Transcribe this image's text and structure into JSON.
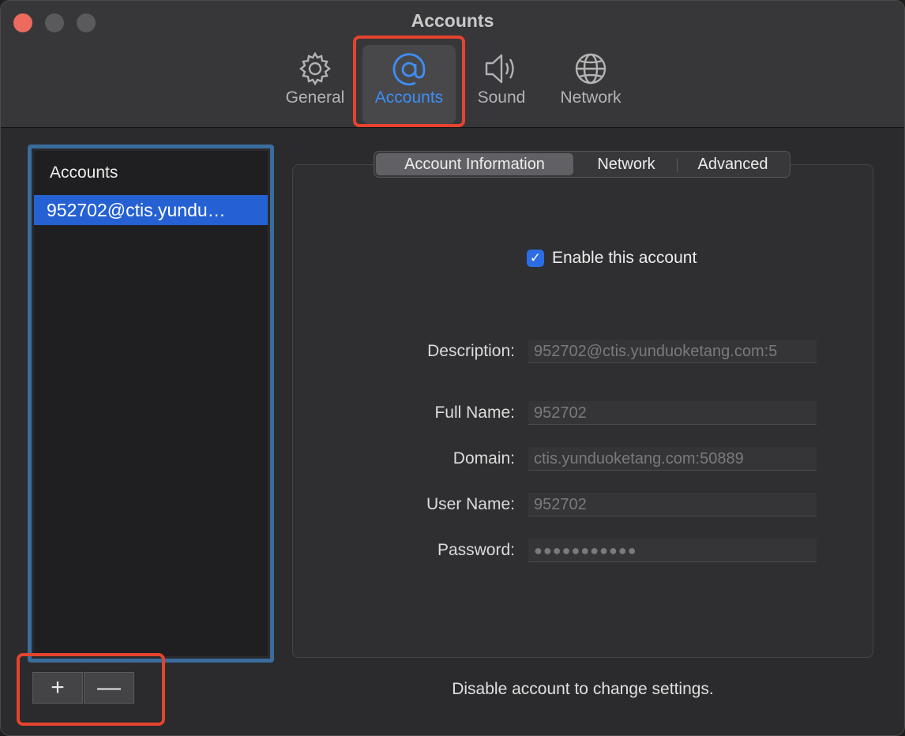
{
  "window": {
    "title": "Accounts"
  },
  "toolbar": {
    "items": [
      {
        "label": "General",
        "icon": "gear-icon"
      },
      {
        "label": "Accounts",
        "icon": "at-icon",
        "selected": true
      },
      {
        "label": "Sound",
        "icon": "speaker-icon"
      },
      {
        "label": "Network",
        "icon": "globe-icon"
      }
    ]
  },
  "sidebar": {
    "header": "Accounts",
    "items": [
      {
        "label": "952702@ctis.yundu…",
        "selected": true
      }
    ],
    "add_label": "+",
    "remove_label": "—"
  },
  "tabs": [
    {
      "label": "Account Information",
      "selected": true
    },
    {
      "label": "Network"
    },
    {
      "label": "Advanced"
    }
  ],
  "form": {
    "enable_label": "Enable this account",
    "enable_checked": true,
    "fields": [
      {
        "label": "Description:",
        "value": "952702@ctis.yunduoketang.com:5"
      },
      {
        "label": "Full Name:",
        "value": "952702"
      },
      {
        "label": "Domain:",
        "value": "ctis.yunduoketang.com:50889"
      },
      {
        "label": "User Name:",
        "value": "952702"
      },
      {
        "label": "Password:",
        "value": "●●●●●●●●●●●"
      }
    ]
  },
  "footer_note": "Disable account to change settings.",
  "colors": {
    "accent": "#3d8ef6",
    "selection": "#2561d2",
    "highlight_red": "#e5432e",
    "highlight_blue": "#3a6c9c"
  }
}
